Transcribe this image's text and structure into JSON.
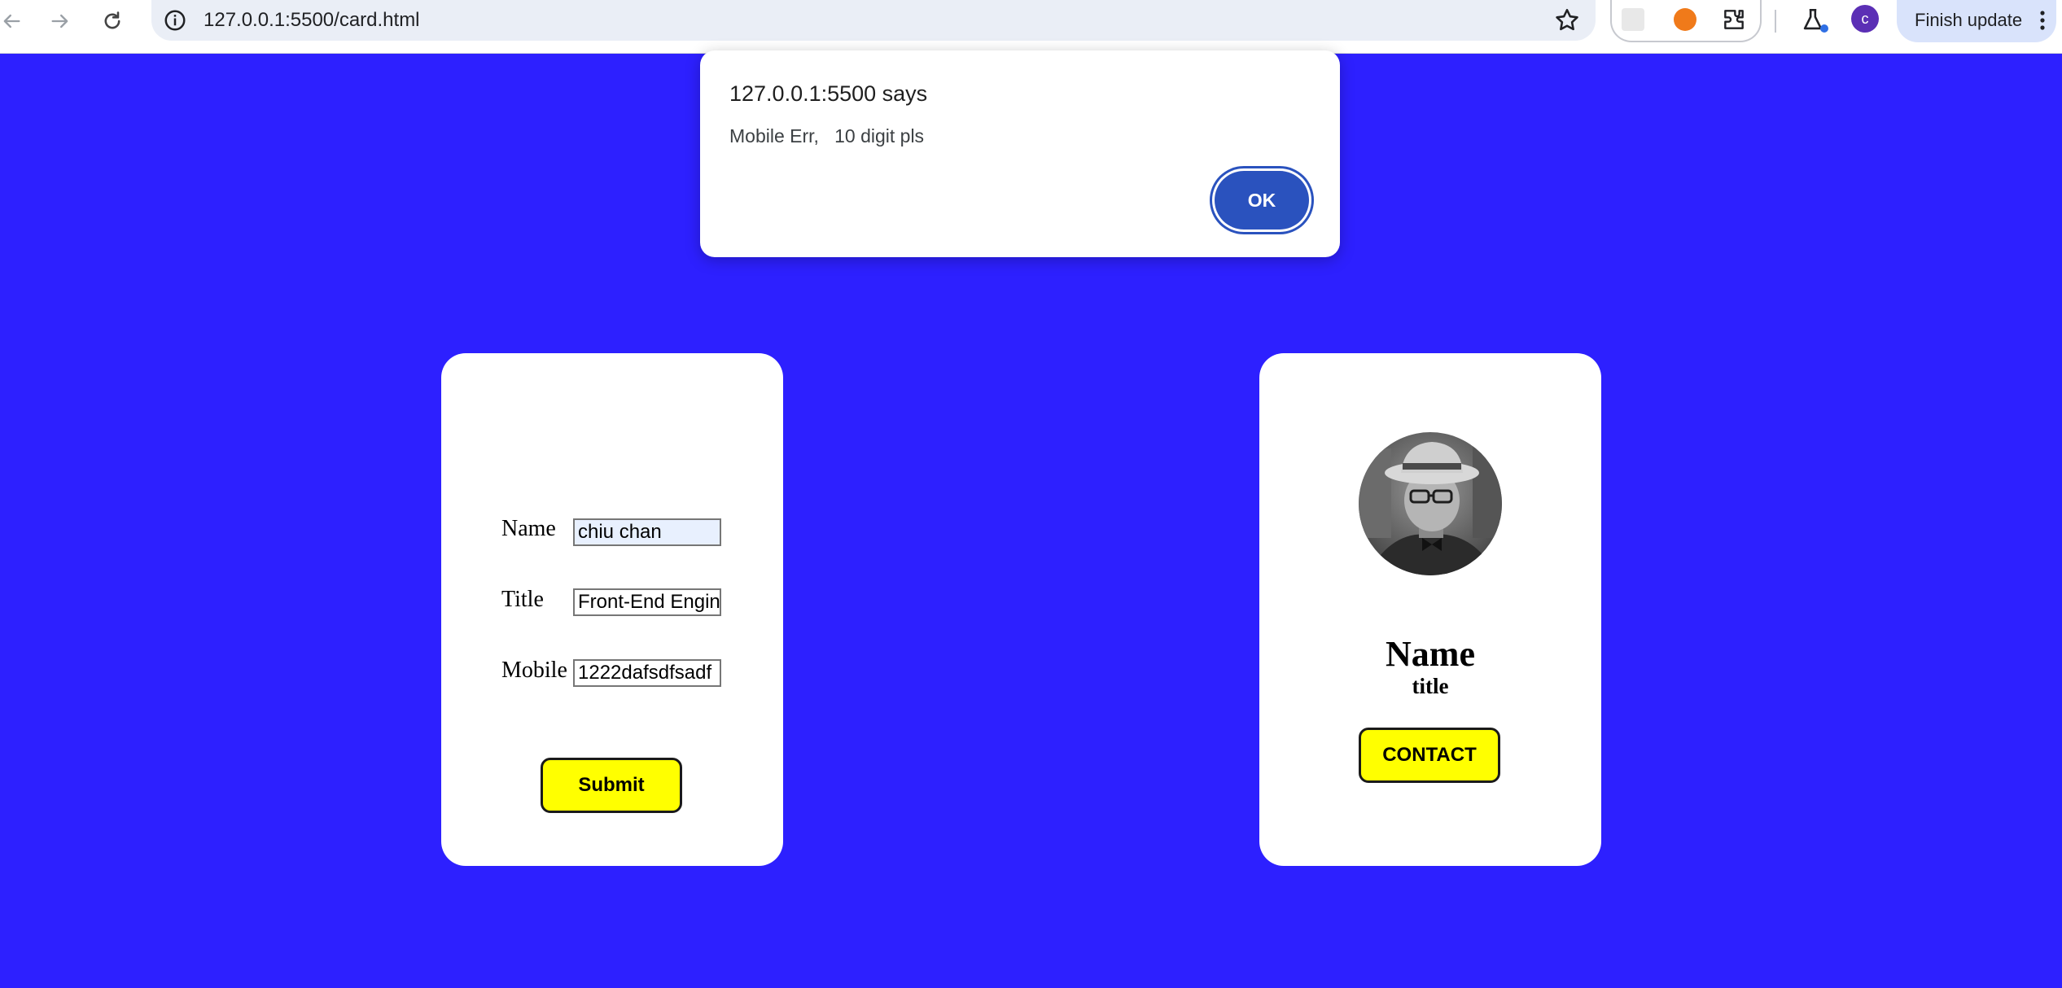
{
  "browser": {
    "url": "127.0.0.1:5500/card.html",
    "profile_initial": "c",
    "finish_update_label": "Finish update",
    "icons": [
      "back-icon",
      "forward-icon",
      "reload-icon",
      "site-info-icon",
      "bookmark-star-icon",
      "extension-icon",
      "labs-icon",
      "more-menu-icon"
    ]
  },
  "alert": {
    "title": "127.0.0.1:5500 says",
    "message": "Mobile Err,   10 digit pls",
    "ok_label": "OK"
  },
  "form": {
    "fields": [
      {
        "label": "Name",
        "value": "chiu chan"
      },
      {
        "label": "Title",
        "value": "Front-End Engineer"
      },
      {
        "label": "Mobile",
        "value": "1222dafsdfsadf"
      }
    ],
    "submit_label": "Submit"
  },
  "profile": {
    "name": "Name",
    "title": "title",
    "contact_label": "CONTACT"
  },
  "colors": {
    "page_background": "#2d20ff",
    "button_yellow": "#ffff00",
    "dialog_button": "#2a52be"
  }
}
